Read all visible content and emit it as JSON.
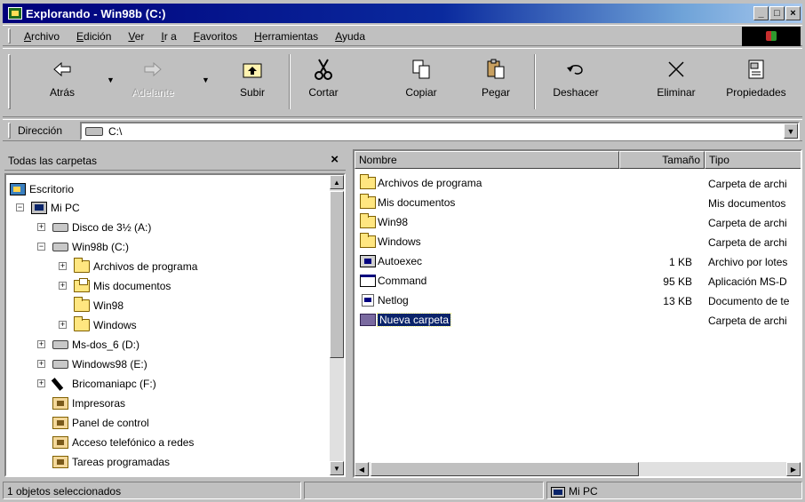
{
  "window": {
    "title": "Explorando - Win98b (C:)",
    "buttons": {
      "minimize": "_",
      "maximize": "□",
      "close": "×"
    }
  },
  "menu": [
    "Archivo",
    "Edición",
    "Ver",
    "Ir a",
    "Favoritos",
    "Herramientas",
    "Ayuda"
  ],
  "toolbar": {
    "back": "Atrás",
    "forward": "Adelante",
    "up": "Subir",
    "cut": "Cortar",
    "copy": "Copiar",
    "paste": "Pegar",
    "undo": "Deshacer",
    "delete": "Eliminar",
    "properties": "Propiedades"
  },
  "address": {
    "label": "Dirección",
    "value": "C:\\"
  },
  "tree": {
    "header": "Todas las carpetas",
    "close_glyph": "×",
    "items": [
      {
        "label": "Escritorio",
        "icon": "desktop-icon"
      },
      {
        "label": "Mi PC",
        "icon": "computer-icon"
      },
      {
        "label": "Disco de 3½ (A:)",
        "icon": "floppy-icon"
      },
      {
        "label": "Win98b (C:)",
        "icon": "hard-drive-icon"
      },
      {
        "label": "Archivos de programa",
        "icon": "folder-icon"
      },
      {
        "label": "Mis documentos",
        "icon": "my-documents-icon"
      },
      {
        "label": "Win98",
        "icon": "folder-icon"
      },
      {
        "label": "Windows",
        "icon": "folder-icon"
      },
      {
        "label": "Ms-dos_6 (D:)",
        "icon": "hard-drive-icon"
      },
      {
        "label": "Windows98 (E:)",
        "icon": "hard-drive-icon"
      },
      {
        "label": "Bricomaniapc (F:)",
        "icon": "network-drive-icon"
      },
      {
        "label": "Impresoras",
        "icon": "printers-icon"
      },
      {
        "label": "Panel de control",
        "icon": "control-panel-icon"
      },
      {
        "label": "Acceso telefónico a redes",
        "icon": "dial-up-icon"
      },
      {
        "label": "Tareas programadas",
        "icon": "scheduled-tasks-icon"
      }
    ]
  },
  "list": {
    "columns": [
      "Nombre",
      "Tamaño",
      "Tipo"
    ],
    "rows": [
      {
        "name": "Archivos de programa",
        "size": "",
        "type": "Carpeta de archi",
        "icon": "folder-icon"
      },
      {
        "name": "Mis documentos",
        "size": "",
        "type": "Mis documentos",
        "icon": "folder-icon"
      },
      {
        "name": "Win98",
        "size": "",
        "type": "Carpeta de archi",
        "icon": "folder-icon"
      },
      {
        "name": "Windows",
        "size": "",
        "type": "Carpeta de archi",
        "icon": "folder-icon"
      },
      {
        "name": "Autoexec",
        "size": "1 KB",
        "type": "Archivo por lotes",
        "icon": "batch-file-icon"
      },
      {
        "name": "Command",
        "size": "95 KB",
        "type": "Aplicación MS-D",
        "icon": "application-icon"
      },
      {
        "name": "Netlog",
        "size": "13 KB",
        "type": "Documento de te",
        "icon": "text-document-icon"
      },
      {
        "name": "Nueva carpeta",
        "size": "",
        "type": "Carpeta de archi",
        "icon": "new-folder-icon"
      }
    ]
  },
  "status": {
    "selected": "1 objetos seleccionados",
    "location": "Mi PC"
  },
  "colors": {
    "titlebar": "#00007b",
    "selection": "#0a246a",
    "face": "#c0c0c0"
  }
}
